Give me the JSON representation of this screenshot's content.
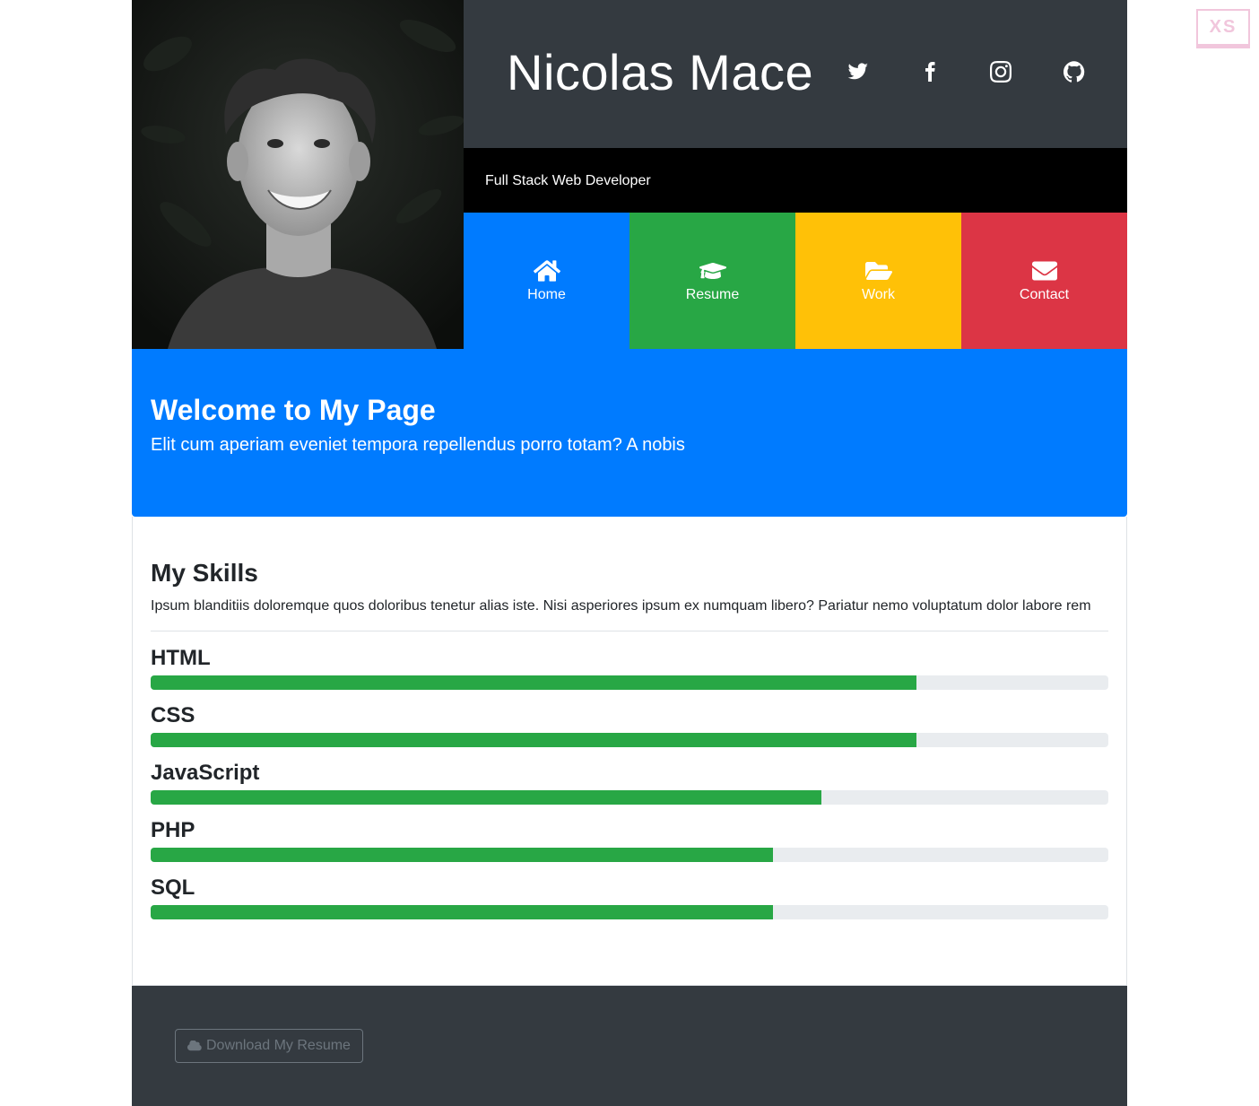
{
  "header": {
    "name": "Nicolas Mace",
    "subtitle": "Full Stack Web Developer",
    "social": [
      {
        "icon": "twitter-icon"
      },
      {
        "icon": "facebook-icon"
      },
      {
        "icon": "instagram-icon"
      },
      {
        "icon": "github-icon"
      }
    ]
  },
  "nav": [
    {
      "label": "Home",
      "icon": "home-icon",
      "color": "#007bff"
    },
    {
      "label": "Resume",
      "icon": "graduation-cap-icon",
      "color": "#28a745"
    },
    {
      "label": "Work",
      "icon": "folder-open-icon",
      "color": "#ffc107"
    },
    {
      "label": "Contact",
      "icon": "envelope-icon",
      "color": "#dc3545"
    }
  ],
  "welcome": {
    "title": "Welcome to My Page",
    "text": "Elit cum aperiam eveniet tempora repellendus porro totam? A nobis"
  },
  "skills": {
    "title": "My Skills",
    "intro": "Ipsum blanditiis doloremque quos doloribus tenetur alias iste. Nisi asperiores ipsum ex numquam libero? Pariatur nemo voluptatum dolor labore rem",
    "items": [
      {
        "name": "HTML",
        "percent": 80
      },
      {
        "name": "CSS",
        "percent": 80
      },
      {
        "name": "JavaScript",
        "percent": 70
      },
      {
        "name": "PHP",
        "percent": 65
      },
      {
        "name": "SQL",
        "percent": 65
      }
    ]
  },
  "footer": {
    "download_label": "Download My Resume",
    "download_icon": "cloud-icon"
  },
  "badge": "XS",
  "colors": {
    "dark": "#343a40",
    "primary": "#007bff",
    "success": "#28a745",
    "warning": "#ffc107",
    "danger": "#dc3545"
  }
}
